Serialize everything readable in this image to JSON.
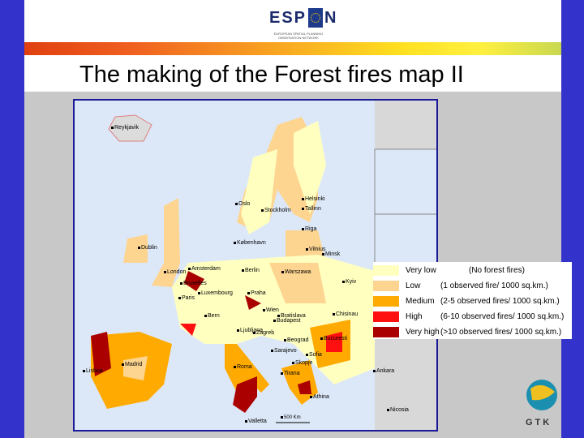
{
  "header": {
    "logo_text_left": "ESP",
    "logo_text_right": "N",
    "tagline": "EUROPEAN SPATIAL PLANNING OBSERVATION NETWORK"
  },
  "title": "The making of the Forest fires map II",
  "map": {
    "cities": [
      "Reykjavik",
      "Oslo",
      "Stockholm",
      "Helsinki",
      "Tallinn",
      "Riga",
      "Vilnius",
      "Minsk",
      "København",
      "Dublin",
      "London",
      "Amsterdam",
      "Berlin",
      "Warszawa",
      "Kyiv",
      "Bruxelles",
      "Luxembourg",
      "Paris",
      "Praha",
      "Wien",
      "Bratislava",
      "Budapest",
      "Bern",
      "Ljubljana",
      "Zagreb",
      "Beograd",
      "Sarajevo",
      "Chisinau",
      "Bucuresti",
      "Sofia",
      "Skopje",
      "Tirana",
      "Roma",
      "Madrid",
      "Lisboa",
      "Athina",
      "Valletta",
      "Ankara",
      "Nicosia"
    ],
    "scale": "500 Km"
  },
  "legend": [
    {
      "label": "Very low",
      "desc": "(No forest fires)",
      "color": "#ffffc0"
    },
    {
      "label": "Low",
      "desc": "(1 observed fire/ 1000 sq.km.)",
      "color": "#fdd590"
    },
    {
      "label": "Medium",
      "desc": "(2-5 observed fires/ 1000 sq.km.)",
      "color": "#ffaa00"
    },
    {
      "label": "High",
      "desc": "(6-10 observed fires/ 1000 sq.km.)",
      "color": "#ff1010"
    },
    {
      "label": "Very high",
      "desc": "(>10 observed fires/ 1000 sq.km.)",
      "color": "#aa0000"
    }
  ],
  "gtk_logo": "GTK"
}
